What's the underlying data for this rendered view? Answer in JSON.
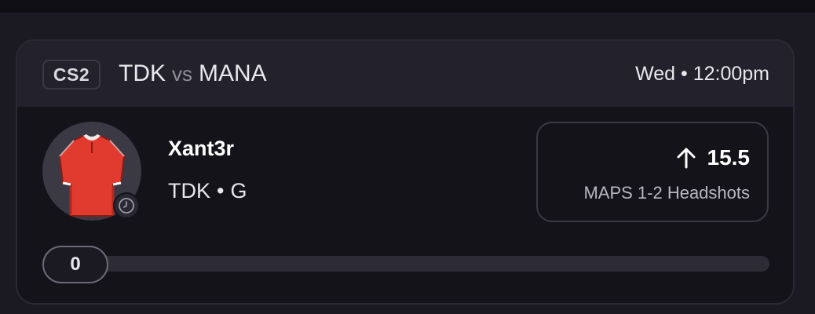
{
  "card": {
    "game_badge": "CS2",
    "home_team": "TDK",
    "vs_label": "vs",
    "away_team": "MANA",
    "time": "Wed • 12:00pm"
  },
  "player": {
    "name": "Xant3r",
    "team": "TDK",
    "separator": "•",
    "position": "G",
    "avatar_icon": "jersey-icon",
    "status_icon": "clock-icon",
    "jersey_color": "#e13a2f"
  },
  "stat": {
    "direction_icon": "arrow-up-icon",
    "line": "15.5",
    "label": "MAPS 1-2 Headshots"
  },
  "slider": {
    "value": "0",
    "fill_fraction": 0
  },
  "colors": {
    "background": "#1b1a23",
    "card": "#14131a",
    "header": "#23222c",
    "border": "#3a3944"
  }
}
